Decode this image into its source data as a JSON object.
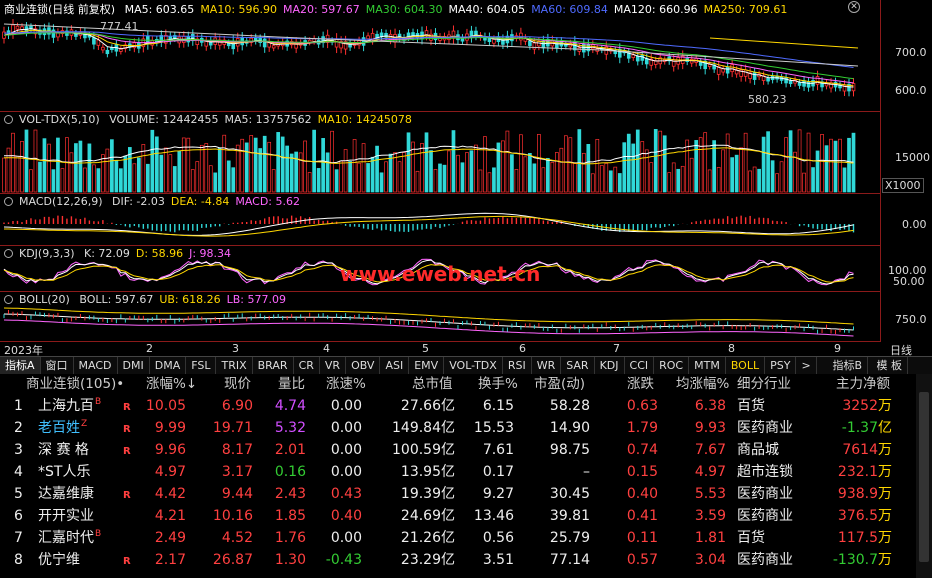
{
  "price": {
    "title": "商业连锁(日线 前复权)",
    "ma": [
      {
        "label": "MA5: 603.65",
        "color": "#ffffff"
      },
      {
        "label": "MA10: 596.90",
        "color": "#ffd700"
      },
      {
        "label": "MA20: 597.67",
        "color": "#ff66ff"
      },
      {
        "label": "MA30: 604.30",
        "color": "#33cc33"
      },
      {
        "label": "MA40: 604.05",
        "color": "#ffffff"
      },
      {
        "label": "MA60: 609.84",
        "color": "#4f6bff"
      },
      {
        "label": "MA120: 660.96",
        "color": "#ffffff"
      },
      {
        "label": "MA250: 709.61",
        "color": "#ffd700"
      }
    ],
    "ticks": [
      "700.0",
      "600.0"
    ],
    "high_label": "777.41",
    "low_label": "580.23"
  },
  "volume": {
    "title": "VOL-TDX(5,10)",
    "items": [
      {
        "label": "VOLUME: 12442455",
        "color": "#dddddd"
      },
      {
        "label": "MA5: 13757562",
        "color": "#dddddd"
      },
      {
        "label": "MA10: 14245078",
        "color": "#ffd700"
      }
    ],
    "ticks": [
      "15000",
      "X1000"
    ]
  },
  "macd": {
    "title": "MACD(12,26,9)",
    "items": [
      {
        "label": "DIF: -2.03",
        "color": "#dddddd"
      },
      {
        "label": "DEA: -4.84",
        "color": "#ffd700"
      },
      {
        "label": "MACD: 5.62",
        "color": "#ff66ff"
      }
    ],
    "ticks": [
      "0.00"
    ]
  },
  "kdj": {
    "title": "KDJ(9,3,3)",
    "items": [
      {
        "label": "K: 72.09",
        "color": "#dddddd"
      },
      {
        "label": "D: 58.96",
        "color": "#ffd700"
      },
      {
        "label": "J: 98.34",
        "color": "#ff66ff"
      }
    ],
    "ticks": [
      "100.00",
      "50.00"
    ],
    "watermark": "www.eweb.net.cn"
  },
  "boll": {
    "title": "BOLL(20)",
    "items": [
      {
        "label": "BOLL: 597.67",
        "color": "#dddddd"
      },
      {
        "label": "UB: 618.26",
        "color": "#ffd700"
      },
      {
        "label": "LB: 577.09",
        "color": "#ff66ff"
      }
    ],
    "ticks": [
      "750.0"
    ]
  },
  "dates": {
    "year": "2023年",
    "months": [
      "2",
      "3",
      "4",
      "5",
      "6",
      "7",
      "8",
      "9"
    ],
    "period": "日线"
  },
  "tabs": [
    "指标A",
    "窗口",
    "MACD",
    "DMI",
    "DMA",
    "FSL",
    "TRIX",
    "BRAR",
    "CR",
    "VR",
    "OBV",
    "ASI",
    "EMV",
    "VOL-TDX",
    "RSI",
    "WR",
    "SAR",
    "KDJ",
    "CCI",
    "ROC",
    "MTM",
    "BOLL",
    "PSY",
    ">"
  ],
  "tabs_right": [
    "指标B",
    "模 板"
  ],
  "table": {
    "headers": {
      "name": "商业连锁(105)•",
      "zf": "涨幅%↓",
      "price": "现价",
      "lb": "量比",
      "zs": "涨速%",
      "mv": "总市值",
      "hs": "换手%",
      "pe": "市盈(动)",
      "zd": "涨跌",
      "avg": "均涨幅%",
      "ind": "细分行业",
      "flow": "主力净额"
    },
    "rows": [
      {
        "idx": "1",
        "name": "上海九百",
        "sup": "B",
        "flag": "R",
        "zf": "10.05",
        "price": "6.90",
        "lb": "4.74",
        "zs": "0.00",
        "mv": "27.66亿",
        "hs": "6.15",
        "pe": "58.28",
        "zd": "0.63",
        "avg": "6.38",
        "ind": "百货",
        "flow_n": "3252",
        "flow_u": "万",
        "flow_color": "red",
        "lb_color": "purple",
        "zs_color": "white",
        "name_color": "white"
      },
      {
        "idx": "2",
        "name": "老百姓",
        "sup": "Z",
        "flag": "R",
        "zf": "9.99",
        "price": "19.71",
        "lb": "5.32",
        "zs": "0.00",
        "mv": "149.84亿",
        "hs": "15.53",
        "pe": "14.90",
        "zd": "1.79",
        "avg": "9.93",
        "ind": "医药商业",
        "flow_n": "-1.37",
        "flow_u": "亿",
        "flow_color": "green",
        "lb_color": "purple",
        "zs_color": "white",
        "name_color": "cyan"
      },
      {
        "idx": "3",
        "name": "深 赛 格",
        "sup": "",
        "flag": "R",
        "zf": "9.96",
        "price": "8.17",
        "lb": "2.01",
        "zs": "0.00",
        "mv": "100.59亿",
        "hs": "7.61",
        "pe": "98.75",
        "zd": "0.74",
        "avg": "7.67",
        "ind": "商品城",
        "flow_n": "7614",
        "flow_u": "万",
        "flow_color": "red",
        "lb_color": "red",
        "zs_color": "white",
        "name_color": "white"
      },
      {
        "idx": "4",
        "name": "*ST人乐",
        "sup": "",
        "flag": "",
        "zf": "4.97",
        "price": "3.17",
        "lb": "0.16",
        "zs": "0.00",
        "mv": "13.95亿",
        "hs": "0.17",
        "pe": "–",
        "zd": "0.15",
        "avg": "4.97",
        "ind": "超市连锁",
        "flow_n": "232.1",
        "flow_u": "万",
        "flow_color": "red",
        "lb_color": "green",
        "zs_color": "white",
        "name_color": "white"
      },
      {
        "idx": "5",
        "name": "达嘉维康",
        "sup": "",
        "flag": "R",
        "zf": "4.42",
        "price": "9.44",
        "lb": "2.43",
        "zs": "0.43",
        "mv": "19.39亿",
        "hs": "9.27",
        "pe": "30.45",
        "zd": "0.40",
        "avg": "5.53",
        "ind": "医药商业",
        "flow_n": "938.9",
        "flow_u": "万",
        "flow_color": "red",
        "lb_color": "red",
        "zs_color": "red",
        "name_color": "white"
      },
      {
        "idx": "6",
        "name": "开开实业",
        "sup": "",
        "flag": "",
        "zf": "4.21",
        "price": "10.16",
        "lb": "1.85",
        "zs": "0.40",
        "mv": "24.69亿",
        "hs": "13.46",
        "pe": "39.81",
        "zd": "0.41",
        "avg": "3.59",
        "ind": "医药商业",
        "flow_n": "376.5",
        "flow_u": "万",
        "flow_color": "red",
        "lb_color": "red",
        "zs_color": "red",
        "name_color": "white"
      },
      {
        "idx": "7",
        "name": "汇嘉时代",
        "sup": "B",
        "flag": "",
        "zf": "2.49",
        "price": "4.52",
        "lb": "1.76",
        "zs": "0.00",
        "mv": "21.26亿",
        "hs": "0.56",
        "pe": "25.79",
        "zd": "0.11",
        "avg": "1.81",
        "ind": "百货",
        "flow_n": "117.5",
        "flow_u": "万",
        "flow_color": "red",
        "lb_color": "red",
        "zs_color": "white",
        "name_color": "white"
      },
      {
        "idx": "8",
        "name": "优宁维",
        "sup": "",
        "flag": "R",
        "zf": "2.17",
        "price": "26.87",
        "lb": "1.30",
        "zs": "-0.43",
        "mv": "23.29亿",
        "hs": "3.51",
        "pe": "77.14",
        "zd": "0.57",
        "avg": "3.04",
        "ind": "医药商业",
        "flow_n": "-130.7",
        "flow_u": "万",
        "flow_color": "green",
        "lb_color": "red",
        "zs_color": "green",
        "name_color": "white"
      }
    ]
  }
}
